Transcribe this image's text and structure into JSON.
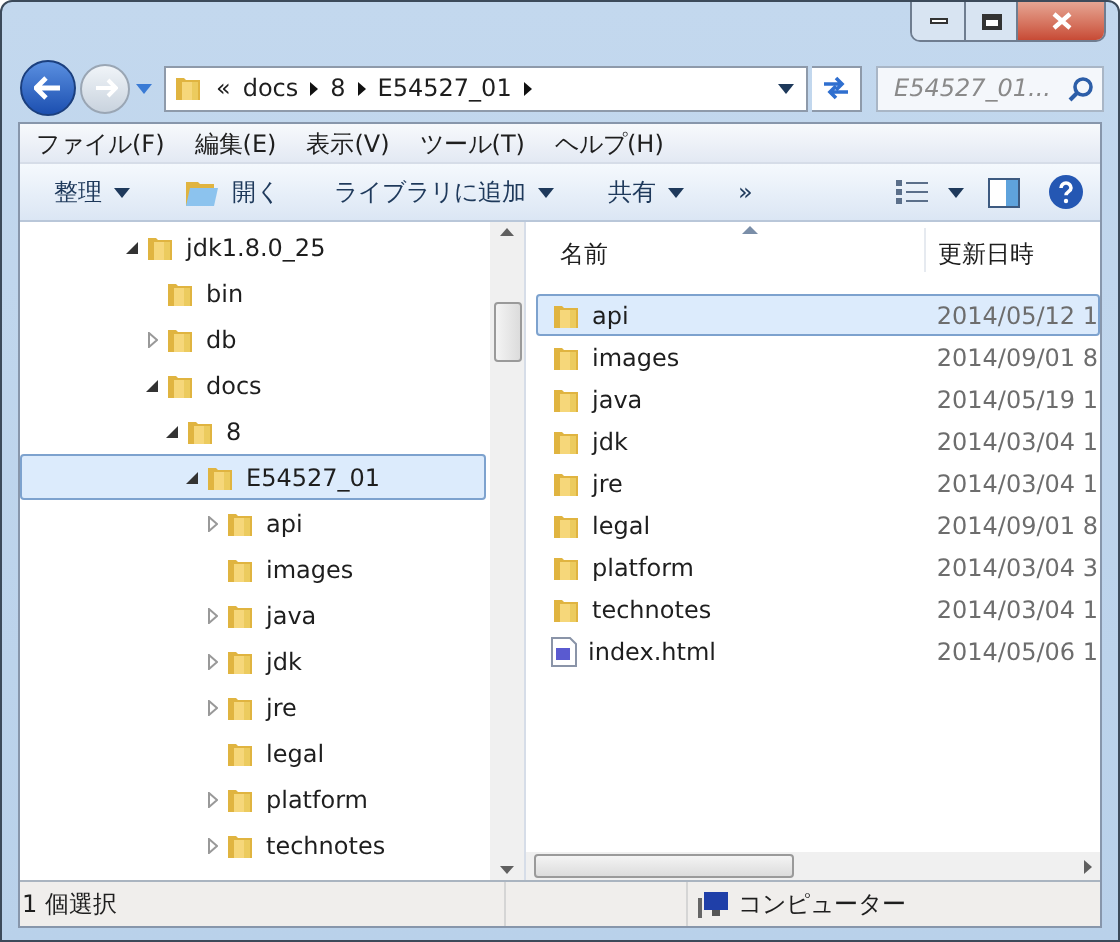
{
  "address_bar": {
    "overflow": "«",
    "crumbs": [
      "docs",
      "8",
      "E54527_01"
    ]
  },
  "search": {
    "placeholder": "E54527_01..."
  },
  "menu": [
    "ファイル(F)",
    "編集(E)",
    "表示(V)",
    "ツール(T)",
    "ヘルプ(H)"
  ],
  "toolbar": [
    {
      "label": "整理",
      "kind": "dropdown"
    },
    {
      "label": "開く",
      "kind": "open"
    },
    {
      "label": "ライブラリに追加",
      "kind": "dropdown"
    },
    {
      "label": "共有",
      "kind": "dropdown"
    },
    {
      "label": "»",
      "kind": "more"
    }
  ],
  "tree": [
    {
      "name": "jdk1.8.0_25",
      "kind": "open",
      "selected": false,
      "children": [
        {
          "name": "bin",
          "kind": "leaf",
          "selected": false
        },
        {
          "name": "db",
          "kind": "closed",
          "selected": false
        },
        {
          "name": "docs",
          "kind": "open",
          "selected": false,
          "children": [
            {
              "name": "8",
              "kind": "open",
              "selected": false,
              "children": [
                {
                  "name": "E54527_01",
                  "kind": "open",
                  "selected": true,
                  "children": [
                    {
                      "name": "api",
                      "kind": "closed",
                      "selected": false
                    },
                    {
                      "name": "images",
                      "kind": "leaf",
                      "selected": false
                    },
                    {
                      "name": "java",
                      "kind": "closed",
                      "selected": false
                    },
                    {
                      "name": "jdk",
                      "kind": "closed",
                      "selected": false
                    },
                    {
                      "name": "jre",
                      "kind": "closed",
                      "selected": false
                    },
                    {
                      "name": "legal",
                      "kind": "leaf",
                      "selected": false
                    },
                    {
                      "name": "platform",
                      "kind": "closed",
                      "selected": false
                    },
                    {
                      "name": "technotes",
                      "kind": "closed",
                      "selected": false
                    }
                  ]
                }
              ]
            }
          ]
        }
      ]
    }
  ],
  "columns": [
    "名前",
    "更新日時"
  ],
  "files": [
    {
      "name": "api",
      "date": "2014/05/12 1",
      "kind": "folder",
      "selected": true
    },
    {
      "name": "images",
      "date": "2014/09/01 8",
      "kind": "folder",
      "selected": false
    },
    {
      "name": "java",
      "date": "2014/05/19 1",
      "kind": "folder",
      "selected": false
    },
    {
      "name": "jdk",
      "date": "2014/03/04 1",
      "kind": "folder",
      "selected": false
    },
    {
      "name": "jre",
      "date": "2014/03/04 1",
      "kind": "folder",
      "selected": false
    },
    {
      "name": "legal",
      "date": "2014/09/01 8",
      "kind": "folder",
      "selected": false
    },
    {
      "name": "platform",
      "date": "2014/03/04 3",
      "kind": "folder",
      "selected": false
    },
    {
      "name": "technotes",
      "date": "2014/03/04 1",
      "kind": "folder",
      "selected": false
    },
    {
      "name": "index.html",
      "date": "2014/05/06 1",
      "kind": "file",
      "selected": false
    }
  ],
  "status_bar": {
    "selection": "1 個選択",
    "location": "コンピューター"
  }
}
